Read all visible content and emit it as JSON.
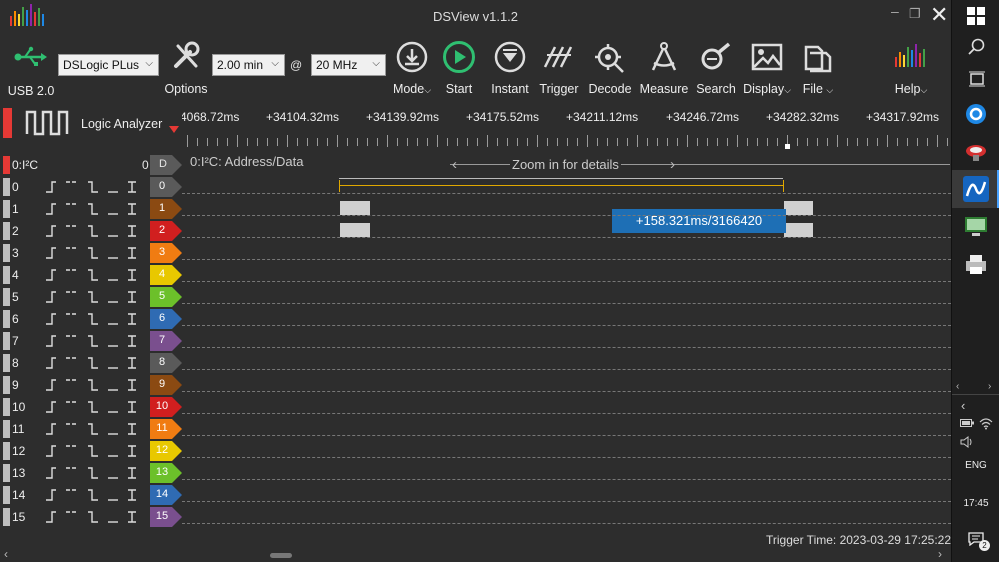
{
  "window": {
    "title": "DSView v1.1.2"
  },
  "colors": {
    "accent_green": "#2fbf71",
    "cursor_yellow": "#e0a800",
    "measure_blue": "#1e6fb5",
    "trigger_red": "#e53935"
  },
  "toolbar": {
    "usb": {
      "label": "USB 2.0",
      "icon": "usb-icon"
    },
    "device": {
      "value": "DSLogic PLus"
    },
    "options": {
      "label": "Options",
      "icon": "wrench-icon"
    },
    "duration": {
      "value": "2.00 min"
    },
    "at": "@",
    "rate": {
      "value": "20 MHz"
    },
    "mode": {
      "label": "Mode"
    },
    "start": {
      "label": "Start"
    },
    "instant": {
      "label": "Instant"
    },
    "trigger": {
      "label": "Trigger"
    },
    "decode": {
      "label": "Decode"
    },
    "measure": {
      "label": "Measure"
    },
    "search": {
      "label": "Search"
    },
    "display": {
      "label": "Display"
    },
    "file": {
      "label": "File"
    },
    "help": {
      "label": "Help"
    }
  },
  "panel": {
    "title": "Logic Analyzer"
  },
  "ruler": {
    "labels": [
      "4068.72ms",
      "+34104.32ms",
      "+34139.92ms",
      "+34175.52ms",
      "+34211.12ms",
      "+34246.72ms",
      "+34282.32ms",
      "+34317.92ms"
    ]
  },
  "decoder": {
    "name": "0:I²C",
    "index": "0",
    "tag": "D",
    "annotation": "0:I²C: Address/Data",
    "zoom_hint": "Zoom in for details"
  },
  "channels": [
    {
      "name": "0",
      "tag_color": "#5a5a5a"
    },
    {
      "name": "1",
      "tag_color": "#8b4a12"
    },
    {
      "name": "2",
      "tag_color": "#d11f1f"
    },
    {
      "name": "3",
      "tag_color": "#f07c12"
    },
    {
      "name": "4",
      "tag_color": "#e8c800"
    },
    {
      "name": "5",
      "tag_color": "#6cc02a"
    },
    {
      "name": "6",
      "tag_color": "#2f6bb3"
    },
    {
      "name": "7",
      "tag_color": "#7a4f8e"
    },
    {
      "name": "8",
      "tag_color": "#5a5a5a"
    },
    {
      "name": "9",
      "tag_color": "#8b4a12"
    },
    {
      "name": "10",
      "tag_color": "#d11f1f"
    },
    {
      "name": "11",
      "tag_color": "#f07c12"
    },
    {
      "name": "12",
      "tag_color": "#e8c800"
    },
    {
      "name": "13",
      "tag_color": "#6cc02a"
    },
    {
      "name": "14",
      "tag_color": "#2f6bb3"
    },
    {
      "name": "15",
      "tag_color": "#7a4f8e"
    }
  ],
  "measurement": {
    "label": "+158.321ms/3166420"
  },
  "status": {
    "trigger_time": "Trigger Time: 2023-03-29 17:25:22"
  },
  "taskbar": {
    "lang": "ENG",
    "time": "17:45",
    "notifications": "2"
  }
}
